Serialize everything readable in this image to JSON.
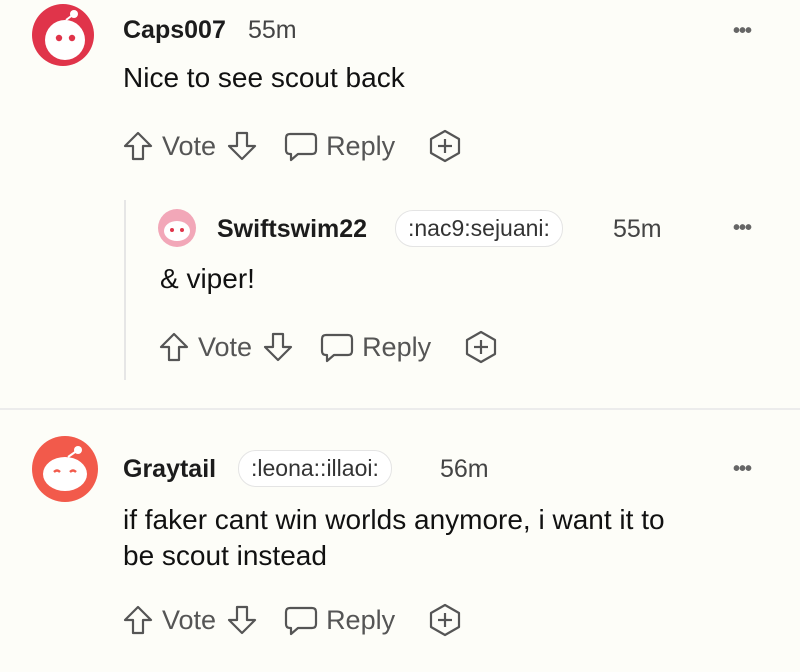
{
  "comments": [
    {
      "username": "Caps007",
      "time": "55m",
      "flair": "",
      "text_lines": [
        "Nice to see scout back"
      ],
      "vote_label": "Vote",
      "reply_label": "Reply",
      "more_icon": "more-icon"
    },
    {
      "username": "Swiftswim22",
      "time": "55m",
      "flair": ":nac9:sejuani:",
      "text_lines": [
        "& viper!"
      ],
      "vote_label": "Vote",
      "reply_label": "Reply",
      "more_icon": "more-icon"
    },
    {
      "username": "Graytail",
      "time": "56m",
      "flair": ":leona::illaoi:",
      "text_lines": [
        "if faker cant win worlds anymore, i want it to",
        "be scout instead"
      ],
      "vote_label": "Vote",
      "reply_label": "Reply",
      "more_icon": "more-icon"
    }
  ],
  "colors": {
    "avatar_red": "#e0344a",
    "avatar_pink": "#f2a7b8",
    "avatar_coral": "#f25a4b",
    "icon_gray": "#555555"
  }
}
